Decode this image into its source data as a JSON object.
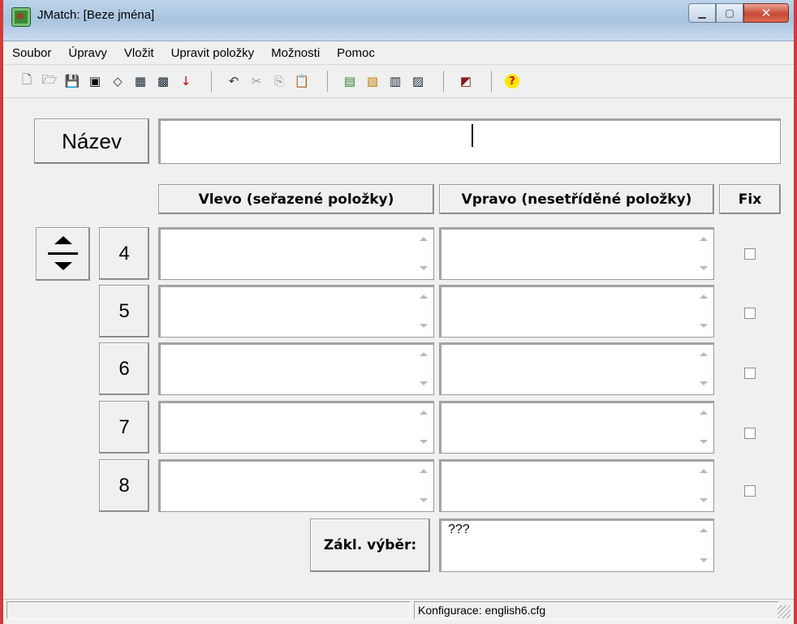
{
  "window": {
    "title": "JMatch: [Beze jména]",
    "accent": "#d23a3a"
  },
  "menu": [
    "Soubor",
    "Úpravy",
    "Vložit",
    "Upravit položky",
    "Možnosti",
    "Pomoc"
  ],
  "toolbar": {
    "icons": [
      "new-file-icon",
      "open-folder-icon",
      "save-icon",
      "save-as-icon",
      "clear-icon",
      "create-web-page-icon",
      "create-web-page-v6-icon",
      "export-icon",
      "undo-icon",
      "cut-icon",
      "copy-icon",
      "paste-icon",
      "add-picture-icon",
      "insert-link-icon",
      "check-icon",
      "config-icon",
      "help-icon"
    ]
  },
  "title_section": {
    "label": "Název",
    "value": ""
  },
  "columns": {
    "left": "Vlevo (seřazené položky)",
    "right": "Vpravo (nesetříděné položky)",
    "fix": "Fix"
  },
  "rows": [
    {
      "num": "4",
      "left": "",
      "right": "",
      "fixed": false
    },
    {
      "num": "5",
      "left": "",
      "right": "",
      "fixed": false
    },
    {
      "num": "6",
      "left": "",
      "right": "",
      "fixed": false
    },
    {
      "num": "7",
      "left": "",
      "right": "",
      "fixed": false
    },
    {
      "num": "8",
      "left": "",
      "right": "",
      "fixed": false
    }
  ],
  "default_choice": {
    "label": "Zákl. výběr:",
    "value": "???"
  },
  "status": {
    "left": "",
    "right": "Konfigurace: english6.cfg"
  }
}
